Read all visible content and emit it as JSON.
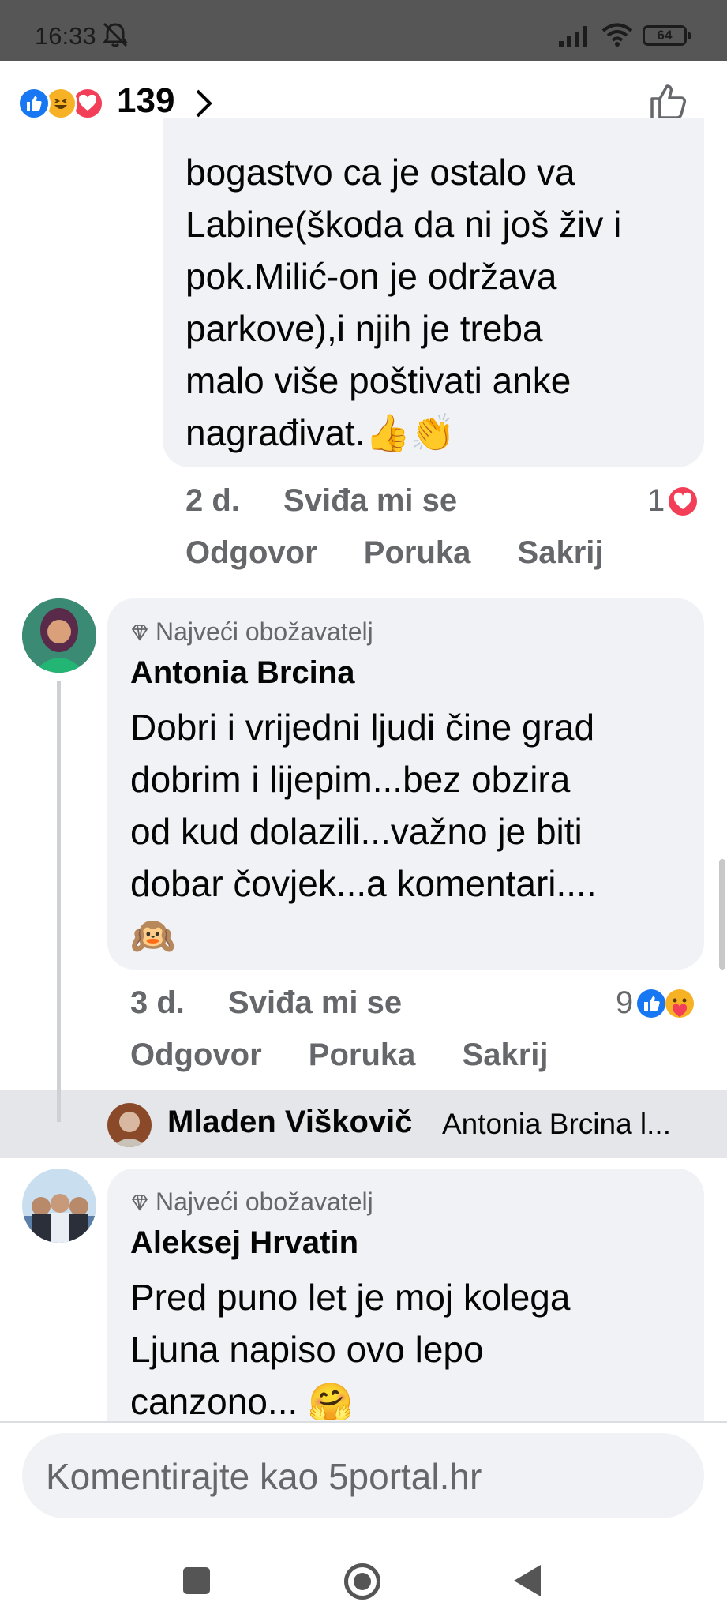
{
  "status_bar": {
    "time": "16:33",
    "battery": "64"
  },
  "reactions_header": {
    "count": "139"
  },
  "comments": [
    {
      "body_lines": [
        "bogastvo ca je ostalo va",
        "Labine(škoda da ni još živ i",
        "pok.Milić-on je održava",
        "parkove),i njih je treba",
        "malo više poštivati anke",
        "nagrađivat."
      ],
      "emoji_trail": "👍👏",
      "age": "2 d.",
      "like": "Sviđa mi se",
      "reply": "Odgovor",
      "message": "Poruka",
      "hide": "Sakrij",
      "reaction_count": "1"
    },
    {
      "badge": "Najveći obožavatelj",
      "author": "Antonia Brcina",
      "body_lines": [
        "Dobri i vrijedni  ljudi čine grad",
        "dobrim i lijepim...bez obzira",
        "od kud dolazili...važno je biti",
        "dobar čovjek...a komentari...."
      ],
      "emoji_trail": "🙉",
      "age": "3 d.",
      "like": "Sviđa mi se",
      "reply": "Odgovor",
      "message": "Poruka",
      "hide": "Sakrij",
      "reaction_count": "9"
    },
    {
      "badge": "Najveći obožavatelj",
      "author": "Aleksej Hrvatin",
      "body_lines": [
        "Pred puno let je moj kolega",
        "Ljuna napiso ovo lepo",
        "canzono..."
      ],
      "emoji_trail": "🤗"
    }
  ],
  "reply_preview": {
    "name": "Mladen Viškovič",
    "text": "Antonia Brcina l..."
  },
  "composer": {
    "placeholder": "Komentirajte kao 5portal.hr"
  },
  "colors": {
    "like_blue": "#1877f2",
    "love_red": "#f33e58",
    "haha_yellow": "#f7b125"
  }
}
